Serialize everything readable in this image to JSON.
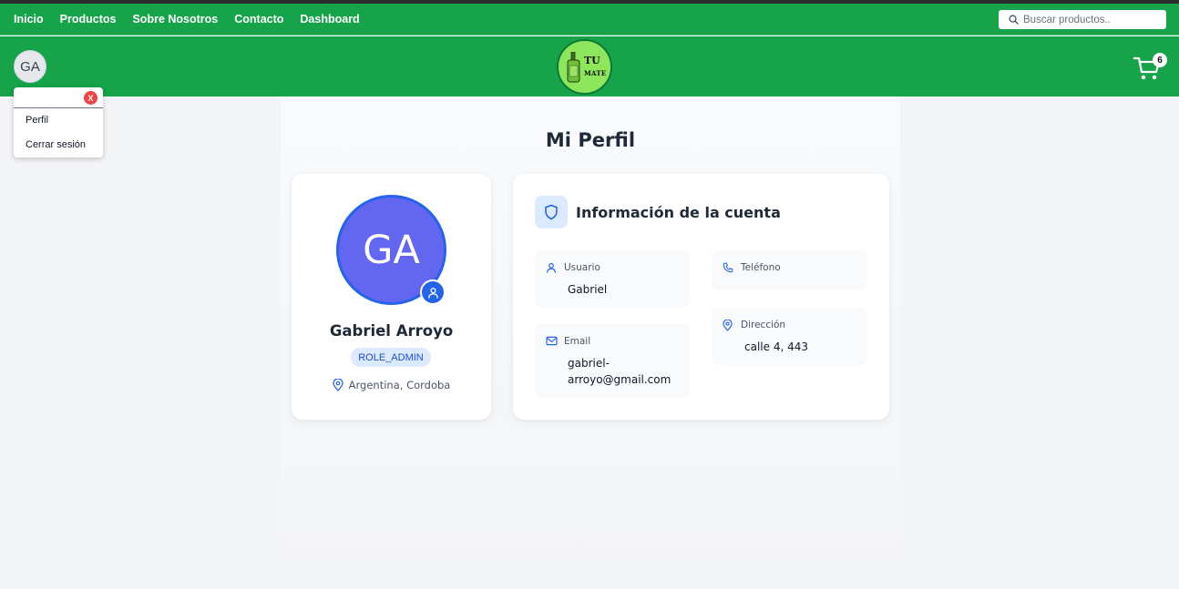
{
  "nav": {
    "links": [
      "Inicio",
      "Productos",
      "Sobre Nosotros",
      "Contacto",
      "Dashboard"
    ],
    "search_placeholder": "Buscar productos.."
  },
  "header": {
    "avatar_initials": "GA",
    "logo_line1": "TU",
    "logo_line2": "MATE",
    "cart_count": "6"
  },
  "dropdown": {
    "close_label": "X",
    "items": [
      "Perfil",
      "Cerrar sesión"
    ]
  },
  "profile": {
    "page_title": "Mi Perfil",
    "avatar_initials": "GA",
    "full_name": "Gabriel Arroyo",
    "role": "ROLE_ADMIN",
    "location": "Argentina, Cordoba"
  },
  "account": {
    "title": "Información de la cuenta",
    "usuario_label": "Usuario",
    "usuario_value": "Gabriel",
    "email_label": "Email",
    "email_value_line1": "gabriel-",
    "email_value_line2": "arroyo@gmail.com",
    "telefono_label": "Teléfono",
    "direccion_label": "Dirección",
    "direccion_value": "calle 4, 443"
  },
  "colors": {
    "brand_green": "#16a34a",
    "accent_blue": "#2563eb",
    "avatar_indigo": "#6366f1",
    "danger_red": "#ef4444"
  },
  "icons": [
    "search-icon",
    "cart-icon",
    "user-icon",
    "shield-icon",
    "mail-icon",
    "phone-icon",
    "map-pin-icon",
    "mate-cup-icon"
  ]
}
